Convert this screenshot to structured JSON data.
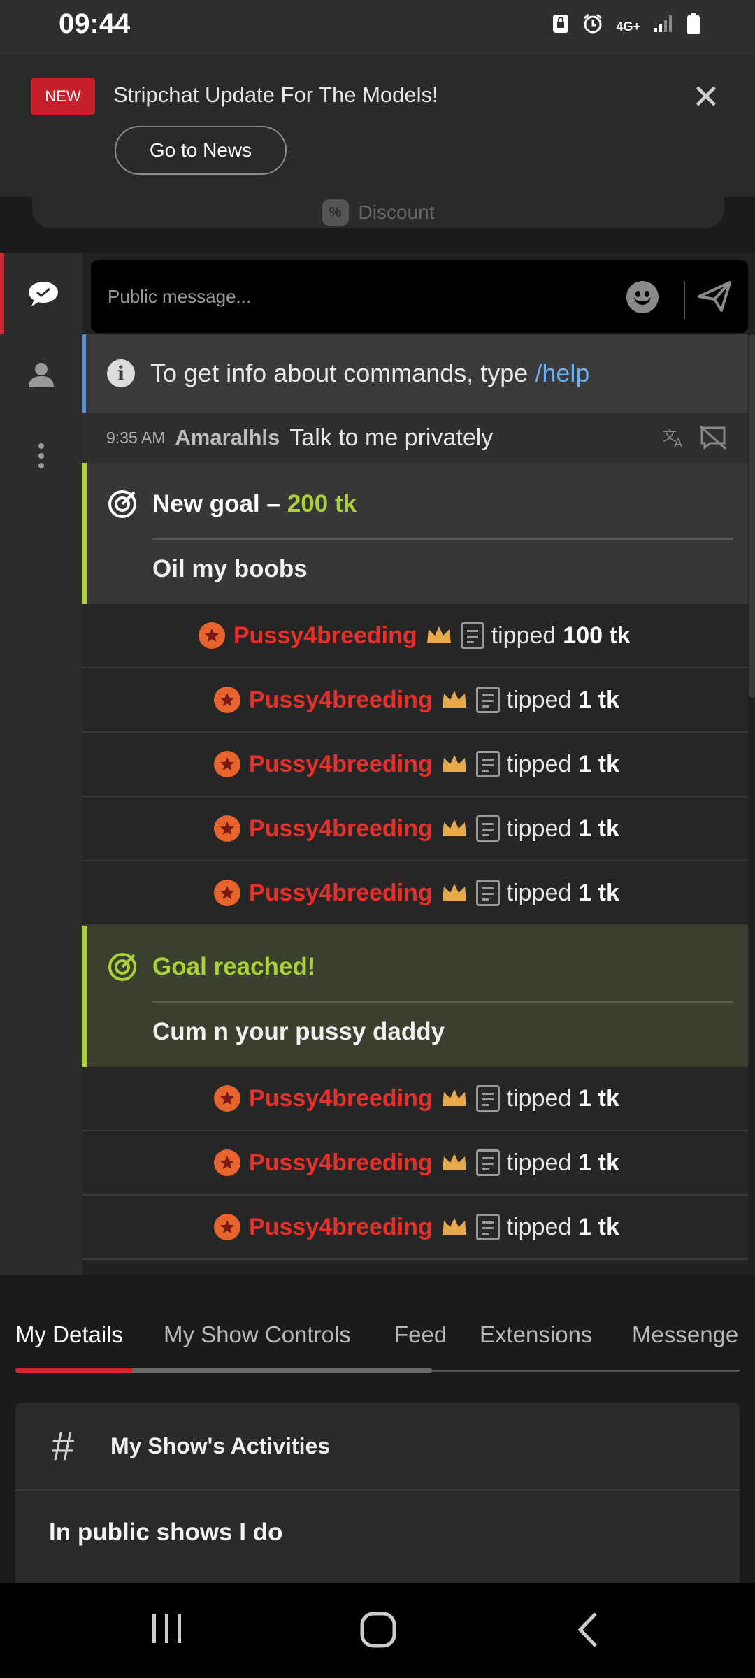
{
  "status_bar": {
    "time": "09:44",
    "network": "4G+"
  },
  "banner": {
    "badge": "NEW",
    "title": "Stripchat Update For The Models!",
    "button": "Go to News",
    "close": "✕"
  },
  "discount": {
    "icon": "%",
    "label": "Discount"
  },
  "chat": {
    "input_placeholder": "Public message...",
    "info": {
      "text": "To get info about commands, type",
      "command": "/help"
    },
    "message": {
      "time": "9:35 AM",
      "user": "Amaralhls",
      "text": "Talk to me privately"
    },
    "goal_new": {
      "prefix": "New goal –",
      "amount": "200 tk",
      "description": "Oil my boobs"
    },
    "goal_reached": {
      "title": "Goal reached!",
      "description": "Cum n your pussy daddy"
    },
    "tips_before": [
      {
        "user": "Pussy4breeding",
        "action": "tipped",
        "amount": "100 tk"
      },
      {
        "user": "Pussy4breeding",
        "action": "tipped",
        "amount": "1 tk"
      },
      {
        "user": "Pussy4breeding",
        "action": "tipped",
        "amount": "1 tk"
      },
      {
        "user": "Pussy4breeding",
        "action": "tipped",
        "amount": "1 tk"
      },
      {
        "user": "Pussy4breeding",
        "action": "tipped",
        "amount": "1 tk"
      }
    ],
    "tips_after": [
      {
        "user": "Pussy4breeding",
        "action": "tipped",
        "amount": "1 tk"
      },
      {
        "user": "Pussy4breeding",
        "action": "tipped",
        "amount": "1 tk"
      },
      {
        "user": "Pussy4breeding",
        "action": "tipped",
        "amount": "1 tk"
      }
    ]
  },
  "tabs": [
    "My Details",
    "My Show Controls",
    "Feed",
    "Extensions",
    "Messenge"
  ],
  "card": {
    "icon": "#",
    "title": "My Show's Activities",
    "subtitle": "In public shows I do"
  },
  "colors": {
    "accent_red": "#d0252e",
    "goal_green": "#a8d13a",
    "tip_user": "#e8302a",
    "command_blue": "#6aaef0"
  }
}
